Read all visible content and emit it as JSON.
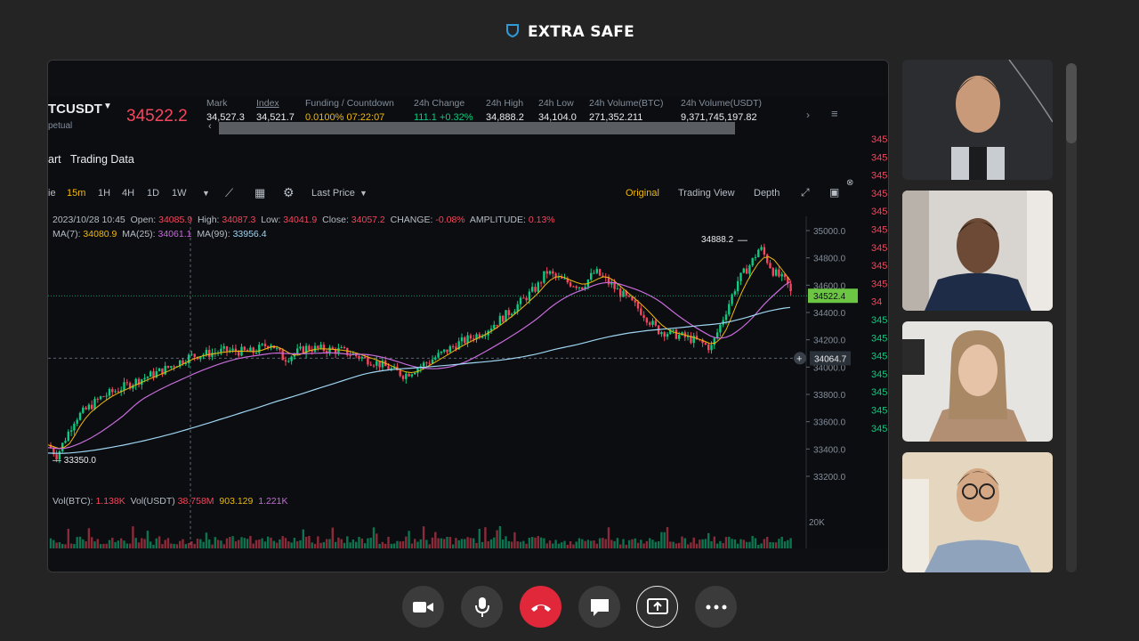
{
  "app": {
    "title": "EXTRA SAFE",
    "icon": "shield-icon"
  },
  "screen": {
    "symbol": "TCUSDT",
    "symbol_sub": "petual",
    "last_price": "34522.2",
    "stats": [
      {
        "label": "Mark",
        "value": "34,527.3",
        "color": "#eaecef"
      },
      {
        "label": "Index",
        "value": "34,521.7",
        "color": "#eaecef"
      },
      {
        "label": "Funding / Countdown",
        "value": "0.0100%  07:22:07",
        "color": "#f0b90b"
      },
      {
        "label": "24h Change",
        "value": "111.1 +0.32%",
        "color": "#0ecb81"
      },
      {
        "label": "24h High",
        "value": "34,888.2",
        "color": "#eaecef"
      },
      {
        "label": "24h Low",
        "value": "34,104.0",
        "color": "#eaecef"
      },
      {
        "label": "24h Volume(BTC)",
        "value": "271,352.211",
        "color": "#eaecef"
      },
      {
        "label": "24h Volume(USDT)",
        "value": "9,371,745,197.82",
        "color": "#eaecef"
      }
    ],
    "tabs": {
      "chart": "art",
      "trading_data": "Trading Data"
    },
    "toolbar": {
      "intervals": [
        "ie",
        "15m",
        "1H",
        "4H",
        "1D",
        "1W"
      ],
      "active_interval": "15m",
      "last_price_label": "Last Price",
      "views": [
        "Original",
        "Trading View",
        "Depth"
      ],
      "active_view": "Original"
    },
    "ohlc": {
      "date": "2023/10/28 10:45",
      "open_label": "Open:",
      "open": "34085.9",
      "high_label": "High:",
      "high": "34087.3",
      "low_label": "Low:",
      "low": "34041.9",
      "close_label": "Close:",
      "close": "34057.2",
      "change_label": "CHANGE:",
      "change": "-0.08%",
      "amplitude_label": "AMPLITUDE:",
      "amplitude": "0.13%"
    },
    "ma": {
      "ma7_label": "MA(7):",
      "ma7": "34080.9",
      "ma25_label": "MA(25):",
      "ma25": "34061.1",
      "ma99_label": "MA(99):",
      "ma99": "33956.4"
    },
    "volume": {
      "btc_label": "Vol(BTC):",
      "btc": "1.138K",
      "usdt_label": "Vol(USDT)",
      "usdt": "38.758M",
      "v1": "903.129",
      "v2": "1.221K"
    },
    "right_axis": {
      "labels": [
        "35000.0",
        "34800.0",
        "34600.0",
        "34400.0",
        "34200.0",
        "34000.0",
        "33800.0",
        "33600.0",
        "33400.0",
        "33200.0"
      ],
      "vol_label": "20K",
      "current_price": "34522.4",
      "crosshair_price": "34064.7"
    },
    "annotations": {
      "high": "34888.2",
      "low": "33350.0"
    }
  },
  "participants": [
    {
      "name": "participant-1",
      "bg": "#2b2d30",
      "skin": "#c89a7a",
      "hair": "#2a211c",
      "shirt": "#c9ccd1"
    },
    {
      "name": "participant-2",
      "bg": "#d8d4cf",
      "skin": "#6d4a35",
      "hair": "#1b1511",
      "shirt": "#1e2c48"
    },
    {
      "name": "participant-3",
      "bg": "#e6e4e1",
      "skin": "#e6c2a6",
      "hair": "#a98866",
      "shirt": "#b28e72"
    },
    {
      "name": "participant-4",
      "bg": "#e5d7bf",
      "skin": "#d4a884",
      "hair": "#1d1a18",
      "shirt": "#8fa3bd"
    }
  ],
  "controls": [
    {
      "name": "camera-button",
      "icon": "camera-icon"
    },
    {
      "name": "microphone-button",
      "icon": "microphone-icon"
    },
    {
      "name": "end-call-button",
      "icon": "phone-end-icon"
    },
    {
      "name": "chat-button",
      "icon": "chat-icon"
    },
    {
      "name": "share-screen-button",
      "icon": "share-screen-icon"
    },
    {
      "name": "more-button",
      "icon": "more-icon"
    }
  ],
  "colors": {
    "bull": "#0ecb81",
    "bear": "#f6465d",
    "accent": "#f0b90b",
    "end_call": "#e0283a",
    "ma7": "#f0b90b",
    "ma25": "#c66bd9",
    "ma99": "#9fd5f2"
  }
}
